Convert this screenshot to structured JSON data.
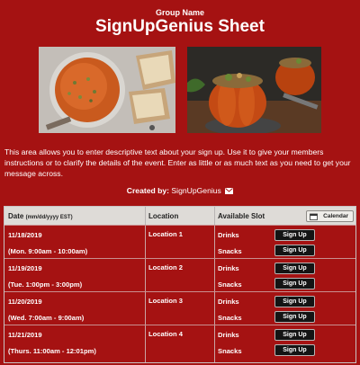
{
  "header": {
    "group_name": "Group Name",
    "title": "SignUpGenius Sheet"
  },
  "images": {
    "left": "soup-bowl-photo",
    "right": "stuffed-pumpkin-photo"
  },
  "description": "This area allows you to enter descriptive text about your sign up. Use it to give your members instructions or to clarify the details of the event. Enter as little or as much text as you need to get your message across.",
  "created_by": {
    "label": "Created by:",
    "name": "SignUpGenius"
  },
  "table": {
    "headers": {
      "date": "Date",
      "date_format": "(mm/dd/yyyy EST)",
      "location": "Location",
      "slot": "Available Slot",
      "calendar": "Calendar"
    },
    "signup_label": "Sign Up",
    "rows": [
      {
        "date": "11/18/2019",
        "time": "(Mon. 9:00am - 10:00am)",
        "location": "Location 1",
        "slots": [
          "Drinks",
          "Snacks"
        ]
      },
      {
        "date": "11/19/2019",
        "time": "(Tue. 1:00pm - 3:00pm)",
        "location": "Location 2",
        "slots": [
          "Drinks",
          "Snacks"
        ]
      },
      {
        "date": "11/20/2019",
        "time": "(Wed. 7:00am - 9:00am)",
        "location": "Location 3",
        "slots": [
          "Drinks",
          "Snacks"
        ]
      },
      {
        "date": "11/21/2019",
        "time": "(Thurs. 11:00am - 12:01pm)",
        "location": "Location 4",
        "slots": [
          "Drinks",
          "Snacks"
        ]
      }
    ]
  },
  "colors": {
    "background": "#a51212",
    "header_bg": "#dedbd7",
    "button_bg": "#141414"
  }
}
